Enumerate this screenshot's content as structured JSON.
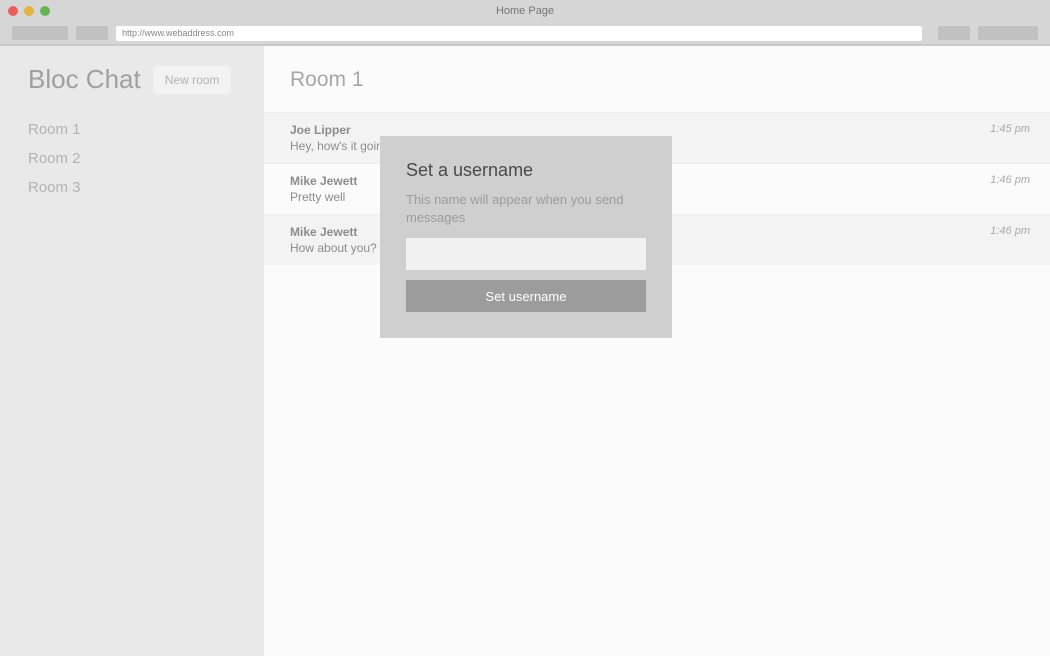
{
  "window": {
    "title": "Home Page",
    "url": "http://www.webaddress.com"
  },
  "sidebar": {
    "app_name": "Bloc Chat",
    "new_room_label": "New room",
    "rooms": [
      {
        "label": "Room 1"
      },
      {
        "label": "Room 2"
      },
      {
        "label": "Room 3"
      }
    ]
  },
  "main": {
    "room_title": "Room 1",
    "messages": [
      {
        "sender": "Joe Lipper",
        "text": "Hey, how's it going?",
        "time": "1:45 pm"
      },
      {
        "sender": "Mike Jewett",
        "text": "Pretty well",
        "time": "1:46 pm"
      },
      {
        "sender": "Mike Jewett",
        "text": "How about you?",
        "time": "1:46 pm"
      }
    ]
  },
  "modal": {
    "title": "Set a username",
    "description": "This name will appear when you send messages",
    "input_value": "",
    "submit_label": "Set username"
  }
}
